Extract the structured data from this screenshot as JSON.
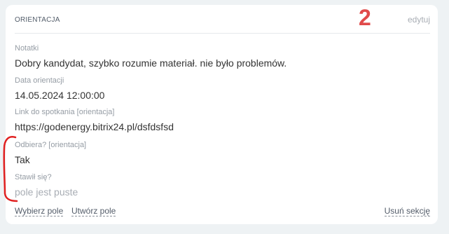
{
  "section": {
    "title": "ORIENTACJA",
    "edit_label": "edytuj"
  },
  "fields": [
    {
      "label": "Notatki",
      "value": "Dobry kandydat, szybko rozumie materiał. nie było problemów."
    },
    {
      "label": "Data orientacji",
      "value": "14.05.2024 12:00:00"
    },
    {
      "label": "Link do spotkania [orientacja]",
      "value": "https://godenergy.bitrix24.pl/dsfdsfsd"
    },
    {
      "label": "Odbiera? [orientacja]",
      "value": "Tak"
    },
    {
      "label": "Stawił się?",
      "value": "pole jest puste"
    }
  ],
  "footer": {
    "select_field": "Wybierz pole",
    "create_field": "Utwórz pole",
    "delete_section": "Usuń sekcję"
  },
  "annotation": {
    "number": "2",
    "color": "#e04a4a"
  }
}
